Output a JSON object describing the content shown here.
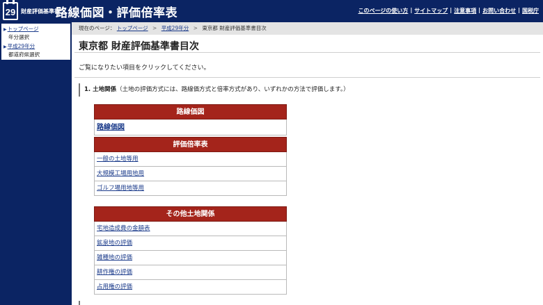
{
  "header": {
    "logo_number": "29",
    "site_small": "財産評価基準書",
    "site_title": "路線価図・評価倍率表",
    "links": [
      {
        "label": "このページの使い方"
      },
      {
        "label": "サイトマップ"
      },
      {
        "label": "注意事項"
      },
      {
        "label": "お問い合わせ"
      }
    ],
    "agency": "国税庁",
    "separator": "|"
  },
  "sidebar": {
    "items": [
      {
        "label": "トップページ",
        "sub": "年分選択"
      },
      {
        "label": "平成29年分",
        "sub": "都道府県選択"
      }
    ]
  },
  "breadcrumb": {
    "prefix": "現在のページ：",
    "items": [
      "トップページ",
      "平成29年分",
      "東京都 財産評価基準書目次"
    ],
    "separator": ">"
  },
  "main": {
    "title": "東京都 財産評価基準書目次",
    "intro": "ご覧になりたい項目をクリックしてください。",
    "section_num": "1. 土地関係",
    "section_desc": "（土地の評価方式には、路線価方式と倍率方式があり、いずれかの方法で評価します。）"
  },
  "panels": [
    {
      "header": "路線価図",
      "items": [
        "路線価図"
      ]
    },
    {
      "header": "評価倍率表",
      "items": [
        "一般の土地等用",
        "大規模工場用地用",
        "ゴルフ場用地等用"
      ]
    },
    {
      "header": "その他土地関係",
      "items": [
        "宅地造成費の金額表",
        "鉱泉地の評価",
        "雑種地の評価",
        "耕作権の評価",
        "占用権の評価"
      ]
    }
  ],
  "colors": {
    "navy": "#0b2463",
    "panel_red": "#a4241b",
    "link_blue": "#1a3a8a"
  }
}
